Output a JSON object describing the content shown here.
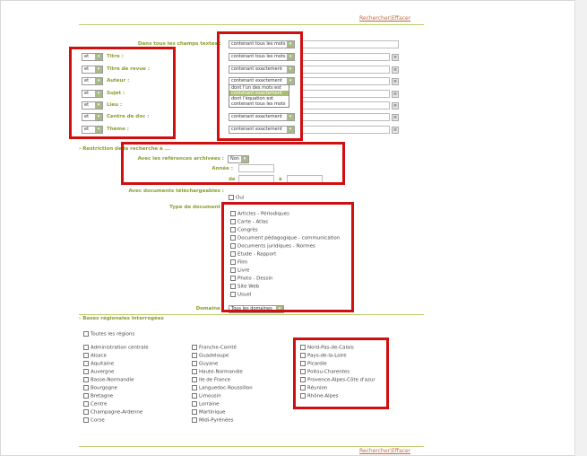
{
  "top_links": {
    "search": "Rechercher",
    "clear": "Effacer"
  },
  "bottom_links": {
    "search": "Rechercher",
    "clear": "Effacer"
  },
  "search": {
    "all_fields_label": "Dans tous les champs textes :",
    "all_fields_op": "contenant tous les mots",
    "rows": [
      {
        "bool": "et",
        "label": "Titre :",
        "op": "contenant tous les mots"
      },
      {
        "bool": "et",
        "label": "Titre de revue :",
        "op": "contenant exactement"
      },
      {
        "bool": "et",
        "label": "Auteur :",
        "op": "contenant exactement"
      },
      {
        "bool": "et",
        "label": "Sujet :",
        "op": ""
      },
      {
        "bool": "et",
        "label": "Lieu :",
        "op": ""
      },
      {
        "bool": "et",
        "label": "Centre de doc :",
        "op": "contenant exactement"
      },
      {
        "bool": "et",
        "label": "Thème :",
        "op": "contenant exactement"
      }
    ],
    "author_dropdown": [
      "dont l'un des mots est",
      "contenant exactement",
      "dont l'équation est",
      "contenant tous les mots"
    ]
  },
  "restriction": {
    "title": "Restriction de la recherche à ...",
    "archived_label": "Avec les références archivées :",
    "archived_value": "Non",
    "year_label": "Année :",
    "from_label": "de",
    "to_label": "à",
    "downloadable_label": "Avec documents téléchargeables :",
    "downloadable_value": "Oui",
    "doctype_label": "Type de document :",
    "doc_types": [
      "Articles - Périodiques",
      "Carte - Atlas",
      "Congrès",
      "Document pédagogique - communication",
      "Documents juridiques - Normes",
      "Etude - Rapport",
      "Film",
      "Livre",
      "Photo - Dessin",
      "Site Web",
      "Usuel"
    ],
    "domain_label": "Domaine :",
    "domain_value": "Tous les domaines"
  },
  "regions": {
    "title": "Bases régionales interrogées",
    "all_label": "Toutes les régions",
    "col1": [
      "Administration centrale",
      "Alsace",
      "Aquitaine",
      "Auvergne",
      "Basse-Normandie",
      "Bourgogne",
      "Bretagne",
      "Centre",
      "Champagne-Ardenne",
      "Corse"
    ],
    "col2": [
      "Franche-Comté",
      "Guadeloupe",
      "Guyane",
      "Haute-Normandie",
      "Ile de France",
      "Languedoc-Roussillon",
      "Limousin",
      "Lorraine",
      "Martinique",
      "Midi-Pyrénées"
    ],
    "col3": [
      "Nord-Pas-de-Calais",
      "Pays-de-la-Loire",
      "Picardie",
      "Poitou-Charentes",
      "Provence-Alpes-Côte d'azur",
      "Réunion",
      "Rhône-Alpes"
    ]
  },
  "colors": {
    "accent": "#8a9d2f",
    "highlight_box": "#d01010",
    "link": "#c56a3a"
  }
}
